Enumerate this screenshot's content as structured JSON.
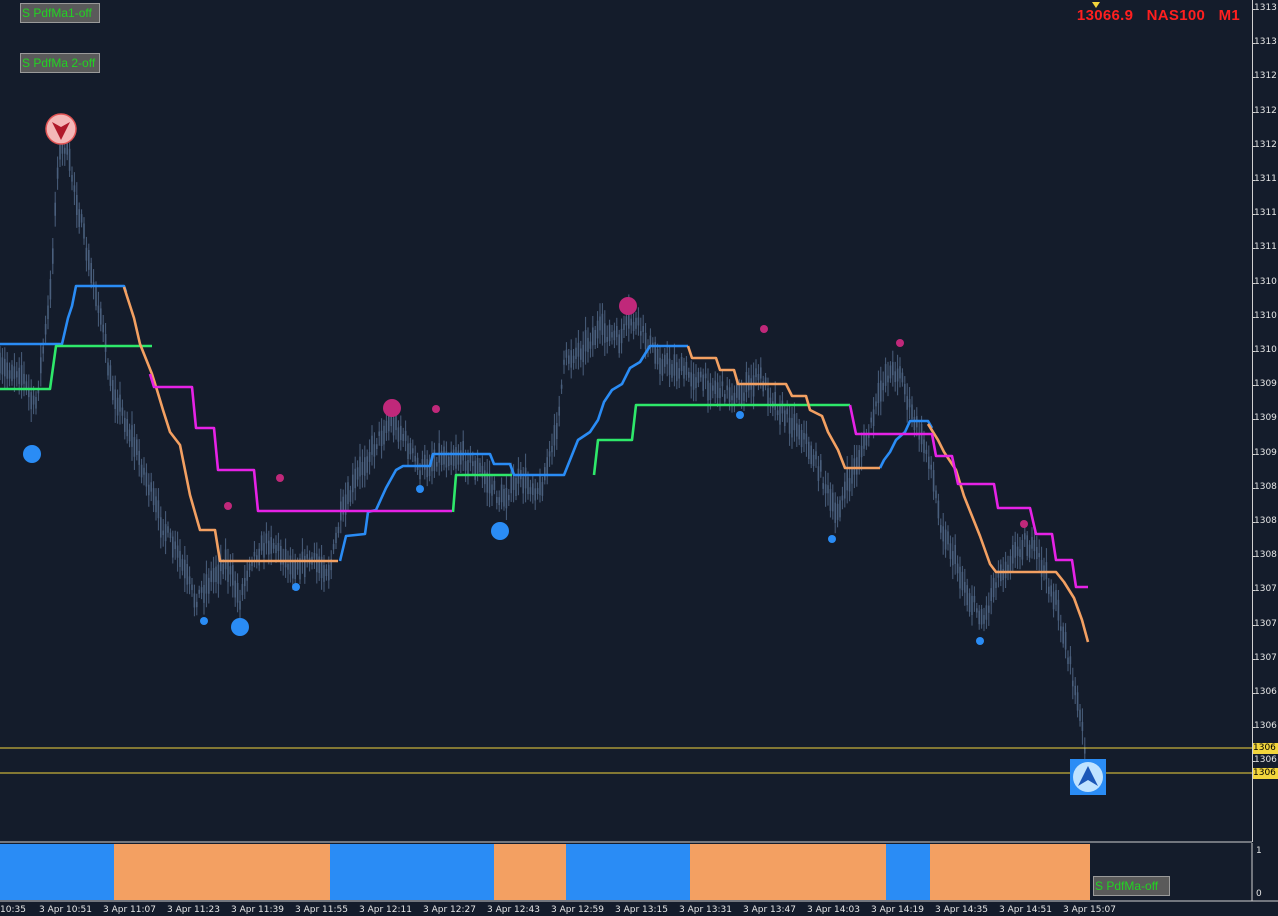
{
  "header": {
    "price": "13066.9",
    "symbol": "NAS100",
    "timeframe": "M1"
  },
  "buttons": {
    "pdfma1": "S  PdfMa1-off",
    "pdfma2": "S  PdfMa 2-off",
    "pdfma_off": "S  PdfMa-off"
  },
  "price_axis": {
    "ticks": [
      "1313",
      "1313",
      "1312",
      "1312",
      "1312",
      "1311",
      "1311",
      "1311",
      "1310",
      "1310",
      "1310",
      "1309",
      "1309",
      "1309",
      "1308",
      "1308",
      "1308",
      "1307",
      "1307",
      "1307",
      "1306",
      "1306",
      "1306"
    ],
    "level_labels": [
      "1306",
      "1306"
    ]
  },
  "time_axis": {
    "labels": [
      "10:35",
      "3 Apr 10:51",
      "3 Apr 11:07",
      "3 Apr 11:23",
      "3 Apr 11:39",
      "3 Apr 11:55",
      "3 Apr 12:11",
      "3 Apr 12:27",
      "3 Apr 12:43",
      "3 Apr 12:59",
      "3 Apr 13:15",
      "3 Apr 13:31",
      "3 Apr 13:47",
      "3 Apr 14:03",
      "3 Apr 14:19",
      "3 Apr 14:35",
      "3 Apr 14:51",
      "3 Apr 15:07"
    ]
  },
  "sub_window": {
    "scale_top": "1",
    "scale_bottom": "0"
  },
  "colors": {
    "background": "#141c2b",
    "candles": "#4a5f7d",
    "blue_line": "#2a8cf5",
    "green_line": "#2ee86a",
    "orange_line": "#f3a062",
    "magenta_line": "#e622e6",
    "level_line": "#f2d53c",
    "dot_blue": "#2a8cf5",
    "dot_magenta": "#c0287a",
    "header_text": "#ff1f1f",
    "button_text": "#22d322"
  },
  "icons": {
    "sell_signal": "down-arrow-circle-icon",
    "buy_signal": "up-arrow-square-icon"
  }
}
